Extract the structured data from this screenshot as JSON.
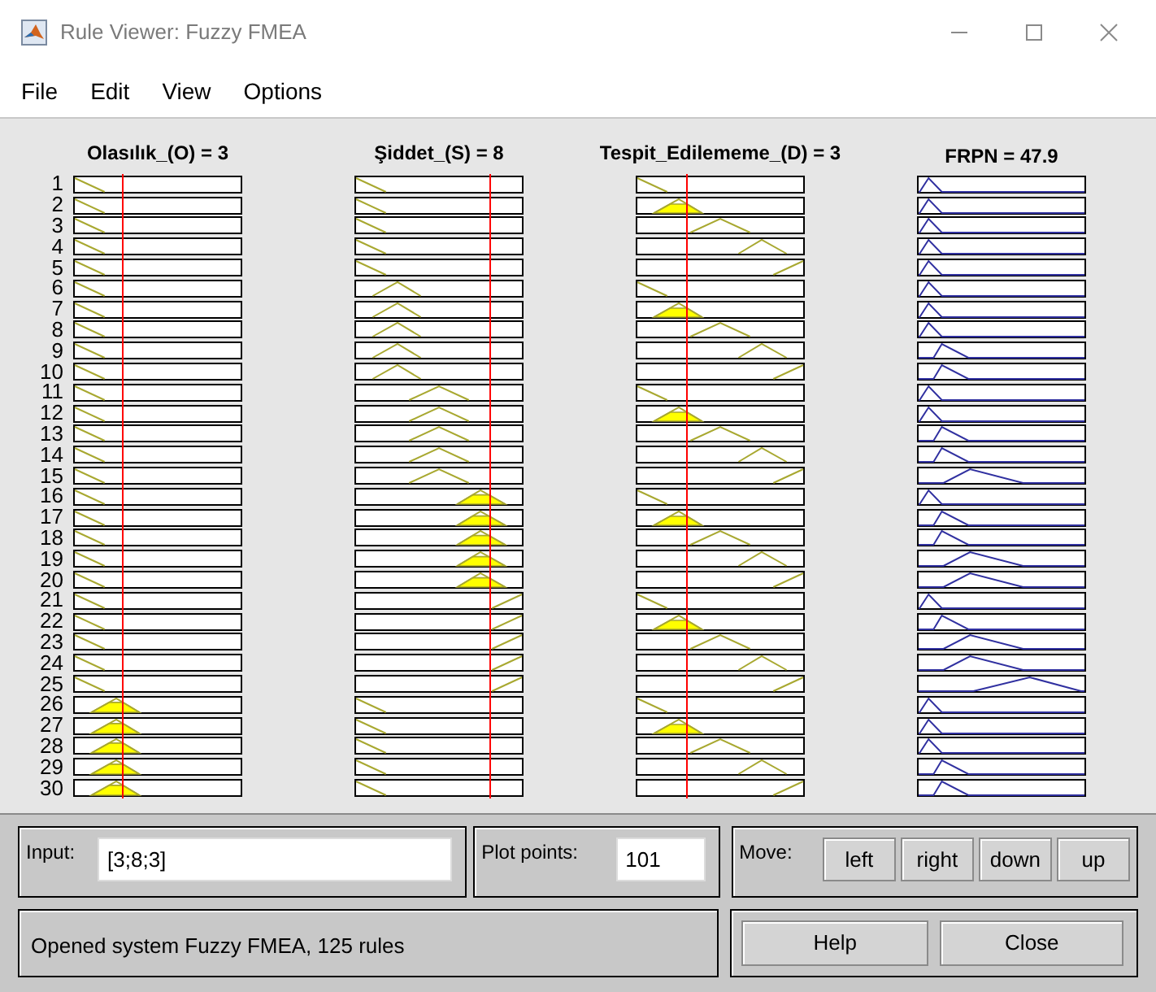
{
  "window": {
    "title": "Rule Viewer: Fuzzy FMEA"
  },
  "menu": [
    "File",
    "Edit",
    "View",
    "Options"
  ],
  "inputs": [
    {
      "label": "Olasılık_(O) = 3"
    },
    {
      "label": "Şiddet_(S) = 8"
    },
    {
      "label": "Tespit_Edilememe_(D) = 3"
    }
  ],
  "output": {
    "label": "FRPN = 47.9"
  },
  "rules": [
    {
      "number": "1",
      "inputs": [
        {
          "kind": "verylow",
          "fired": false
        },
        {
          "kind": "verylow",
          "fired": false
        },
        {
          "kind": "verylow",
          "fired": false
        }
      ],
      "output": {
        "kind": "tiny"
      }
    },
    {
      "number": "2",
      "inputs": [
        {
          "kind": "verylow",
          "fired": false
        },
        {
          "kind": "verylow",
          "fired": false
        },
        {
          "kind": "low",
          "fired": true
        }
      ],
      "output": {
        "kind": "tiny"
      }
    },
    {
      "number": "3",
      "inputs": [
        {
          "kind": "verylow",
          "fired": false
        },
        {
          "kind": "verylow",
          "fired": false
        },
        {
          "kind": "medium",
          "fired": false
        }
      ],
      "output": {
        "kind": "tiny"
      }
    },
    {
      "number": "4",
      "inputs": [
        {
          "kind": "verylow",
          "fired": false
        },
        {
          "kind": "verylow",
          "fired": false
        },
        {
          "kind": "high",
          "fired": false
        }
      ],
      "output": {
        "kind": "tiny"
      }
    },
    {
      "number": "5",
      "inputs": [
        {
          "kind": "verylow",
          "fired": false
        },
        {
          "kind": "verylow",
          "fired": false
        },
        {
          "kind": "veryhigh",
          "fired": false
        }
      ],
      "output": {
        "kind": "tiny"
      }
    },
    {
      "number": "6",
      "inputs": [
        {
          "kind": "verylow",
          "fired": false
        },
        {
          "kind": "low",
          "fired": false
        },
        {
          "kind": "verylow",
          "fired": false
        }
      ],
      "output": {
        "kind": "tiny"
      }
    },
    {
      "number": "7",
      "inputs": [
        {
          "kind": "verylow",
          "fired": false
        },
        {
          "kind": "low",
          "fired": false
        },
        {
          "kind": "low",
          "fired": true
        }
      ],
      "output": {
        "kind": "tiny"
      }
    },
    {
      "number": "8",
      "inputs": [
        {
          "kind": "verylow",
          "fired": false
        },
        {
          "kind": "low",
          "fired": false
        },
        {
          "kind": "medium",
          "fired": false
        }
      ],
      "output": {
        "kind": "tiny"
      }
    },
    {
      "number": "9",
      "inputs": [
        {
          "kind": "verylow",
          "fired": false
        },
        {
          "kind": "low",
          "fired": false
        },
        {
          "kind": "high",
          "fired": false
        }
      ],
      "output": {
        "kind": "small"
      }
    },
    {
      "number": "10",
      "inputs": [
        {
          "kind": "verylow",
          "fired": false
        },
        {
          "kind": "low",
          "fired": false
        },
        {
          "kind": "veryhigh",
          "fired": false
        }
      ],
      "output": {
        "kind": "small"
      }
    },
    {
      "number": "11",
      "inputs": [
        {
          "kind": "verylow",
          "fired": false
        },
        {
          "kind": "medium",
          "fired": false
        },
        {
          "kind": "verylow",
          "fired": false
        }
      ],
      "output": {
        "kind": "tiny"
      }
    },
    {
      "number": "12",
      "inputs": [
        {
          "kind": "verylow",
          "fired": false
        },
        {
          "kind": "medium",
          "fired": false
        },
        {
          "kind": "low",
          "fired": true
        }
      ],
      "output": {
        "kind": "tiny"
      }
    },
    {
      "number": "13",
      "inputs": [
        {
          "kind": "verylow",
          "fired": false
        },
        {
          "kind": "medium",
          "fired": false
        },
        {
          "kind": "medium",
          "fired": false
        }
      ],
      "output": {
        "kind": "small"
      }
    },
    {
      "number": "14",
      "inputs": [
        {
          "kind": "verylow",
          "fired": false
        },
        {
          "kind": "medium",
          "fired": false
        },
        {
          "kind": "high",
          "fired": false
        }
      ],
      "output": {
        "kind": "small"
      }
    },
    {
      "number": "15",
      "inputs": [
        {
          "kind": "verylow",
          "fired": false
        },
        {
          "kind": "medium",
          "fired": false
        },
        {
          "kind": "veryhigh",
          "fired": false
        }
      ],
      "output": {
        "kind": "medium"
      }
    },
    {
      "number": "16",
      "inputs": [
        {
          "kind": "verylow",
          "fired": false
        },
        {
          "kind": "high",
          "fired": true
        },
        {
          "kind": "verylow",
          "fired": false
        }
      ],
      "output": {
        "kind": "tiny"
      }
    },
    {
      "number": "17",
      "inputs": [
        {
          "kind": "verylow",
          "fired": false
        },
        {
          "kind": "high",
          "fired": true
        },
        {
          "kind": "low",
          "fired": true
        }
      ],
      "output": {
        "kind": "small"
      }
    },
    {
      "number": "18",
      "inputs": [
        {
          "kind": "verylow",
          "fired": false
        },
        {
          "kind": "high",
          "fired": true
        },
        {
          "kind": "medium",
          "fired": false
        }
      ],
      "output": {
        "kind": "small"
      }
    },
    {
      "number": "19",
      "inputs": [
        {
          "kind": "verylow",
          "fired": false
        },
        {
          "kind": "high",
          "fired": true
        },
        {
          "kind": "high",
          "fired": false
        }
      ],
      "output": {
        "kind": "medium"
      }
    },
    {
      "number": "20",
      "inputs": [
        {
          "kind": "verylow",
          "fired": false
        },
        {
          "kind": "high",
          "fired": true
        },
        {
          "kind": "veryhigh",
          "fired": false
        }
      ],
      "output": {
        "kind": "medium"
      }
    },
    {
      "number": "21",
      "inputs": [
        {
          "kind": "verylow",
          "fired": false
        },
        {
          "kind": "veryhigh",
          "fired": false
        },
        {
          "kind": "verylow",
          "fired": false
        }
      ],
      "output": {
        "kind": "tiny"
      }
    },
    {
      "number": "22",
      "inputs": [
        {
          "kind": "verylow",
          "fired": false
        },
        {
          "kind": "veryhigh",
          "fired": false
        },
        {
          "kind": "low",
          "fired": true
        }
      ],
      "output": {
        "kind": "small"
      }
    },
    {
      "number": "23",
      "inputs": [
        {
          "kind": "verylow",
          "fired": false
        },
        {
          "kind": "veryhigh",
          "fired": false
        },
        {
          "kind": "medium",
          "fired": false
        }
      ],
      "output": {
        "kind": "medium"
      }
    },
    {
      "number": "24",
      "inputs": [
        {
          "kind": "verylow",
          "fired": false
        },
        {
          "kind": "veryhigh",
          "fired": false
        },
        {
          "kind": "high",
          "fired": false
        }
      ],
      "output": {
        "kind": "medium"
      }
    },
    {
      "number": "25",
      "inputs": [
        {
          "kind": "verylow",
          "fired": false
        },
        {
          "kind": "veryhigh",
          "fired": false
        },
        {
          "kind": "veryhigh",
          "fired": false
        }
      ],
      "output": {
        "kind": "large"
      }
    },
    {
      "number": "26",
      "inputs": [
        {
          "kind": "low",
          "fired": true
        },
        {
          "kind": "verylow",
          "fired": false
        },
        {
          "kind": "verylow",
          "fired": false
        }
      ],
      "output": {
        "kind": "tiny"
      }
    },
    {
      "number": "27",
      "inputs": [
        {
          "kind": "low",
          "fired": true
        },
        {
          "kind": "verylow",
          "fired": false
        },
        {
          "kind": "low",
          "fired": true
        }
      ],
      "output": {
        "kind": "tiny"
      }
    },
    {
      "number": "28",
      "inputs": [
        {
          "kind": "low",
          "fired": true
        },
        {
          "kind": "verylow",
          "fired": false
        },
        {
          "kind": "medium",
          "fired": false
        }
      ],
      "output": {
        "kind": "tiny"
      }
    },
    {
      "number": "29",
      "inputs": [
        {
          "kind": "low",
          "fired": true
        },
        {
          "kind": "verylow",
          "fired": false
        },
        {
          "kind": "high",
          "fired": false
        }
      ],
      "output": {
        "kind": "small"
      }
    },
    {
      "number": "30",
      "inputs": [
        {
          "kind": "low",
          "fired": true
        },
        {
          "kind": "verylow",
          "fired": false
        },
        {
          "kind": "veryhigh",
          "fired": false
        }
      ],
      "output": {
        "kind": "small"
      }
    }
  ],
  "input_field": {
    "label": "Input:",
    "value": "[3;8;3]"
  },
  "plot_points": {
    "label": "Plot points:",
    "value": "101"
  },
  "move": {
    "label": "Move:",
    "buttons": [
      "left",
      "right",
      "down",
      "up"
    ]
  },
  "status": "Opened system Fuzzy FMEA, 125 rules",
  "buttons": [
    "Help",
    "Close"
  ]
}
